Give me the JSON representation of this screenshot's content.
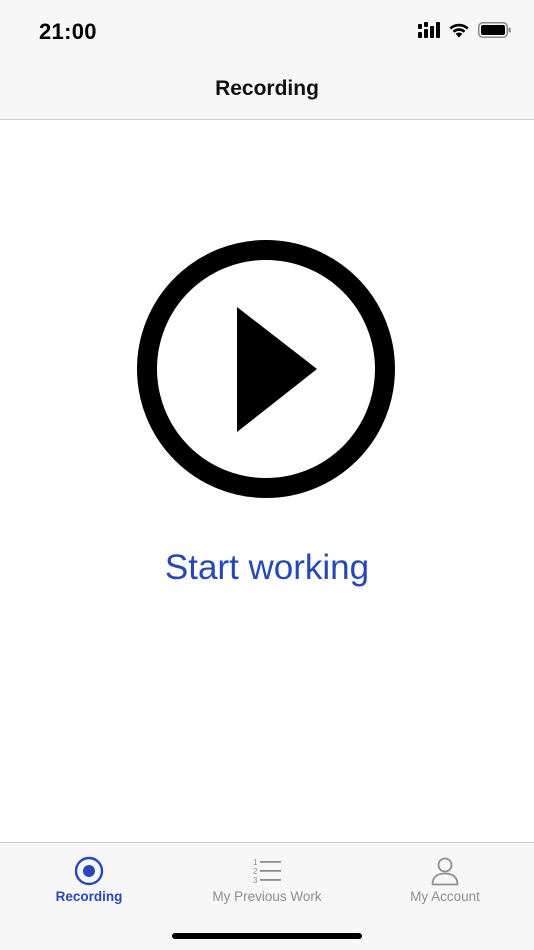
{
  "status_bar": {
    "time": "21:00"
  },
  "nav": {
    "title": "Recording"
  },
  "main": {
    "play_icon": "play-circle-icon",
    "start_label": "Start working"
  },
  "tabs": [
    {
      "label": "Recording",
      "icon": "record-icon",
      "active": true
    },
    {
      "label": "My Previous Work",
      "icon": "numbered-list-icon",
      "active": false
    },
    {
      "label": "My Account",
      "icon": "person-icon",
      "active": false
    }
  ],
  "colors": {
    "accent": "#2747b8",
    "inactive": "#8e8e8e",
    "bar_background": "#f7f7f7"
  }
}
